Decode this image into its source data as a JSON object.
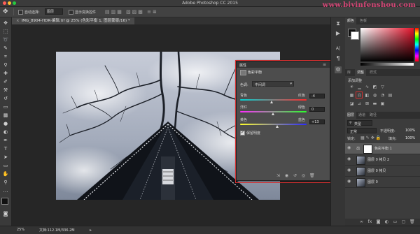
{
  "app": {
    "window_title": "Adobe Photoshop CC 2015",
    "watermark": "www.bjyinfenshou.com"
  },
  "options_bar": {
    "auto_select_label": "自动选择:",
    "layer_value": "图层",
    "transform_label": "显示变换控件"
  },
  "document": {
    "tab_label": "IMG_8904-HDR-编辑.tif @ 25% (色彩平衡 1, 图层蒙版/16) *"
  },
  "status": {
    "zoom": "25%",
    "doc_size": "文档:112.1M/336.2M"
  },
  "properties_panel": {
    "tab_label": "属性",
    "title": "色彩平衡",
    "tone_label": "色调:",
    "tone_value": "中间调",
    "sliders": [
      {
        "left": "青色",
        "right": "红色",
        "value": "-4",
        "position": 0.48
      },
      {
        "left": "洋红",
        "right": "绿色",
        "value": "0",
        "position": 0.5
      },
      {
        "left": "黄色",
        "right": "蓝色",
        "value": "+13",
        "position": 0.56
      }
    ],
    "preserve_label": "保留明度"
  },
  "right_panel": {
    "color_tabs": [
      "颜色",
      "色板"
    ],
    "adjust_tabs": [
      "库",
      "调整",
      "样式"
    ],
    "adjust_heading": "添加调整",
    "layers_tabs": [
      "图层",
      "通道",
      "路径"
    ],
    "kind_label": "类型",
    "blend_mode": "正常",
    "opacity_label": "不透明度:",
    "opacity_value": "100%",
    "lock_label": "锁定:",
    "fill_label": "填充:",
    "fill_value": "100%",
    "layers": [
      {
        "name": "色彩平衡 1",
        "selected": true
      },
      {
        "name": "图层 0 拷贝 2",
        "selected": false
      },
      {
        "name": "图层 0 拷贝",
        "selected": false
      },
      {
        "name": "图层 0",
        "selected": false
      }
    ]
  },
  "colors": {
    "highlight": "#d62f2f",
    "swatch_fg": "#d0021b",
    "swatch_bg": "#ffffff"
  }
}
